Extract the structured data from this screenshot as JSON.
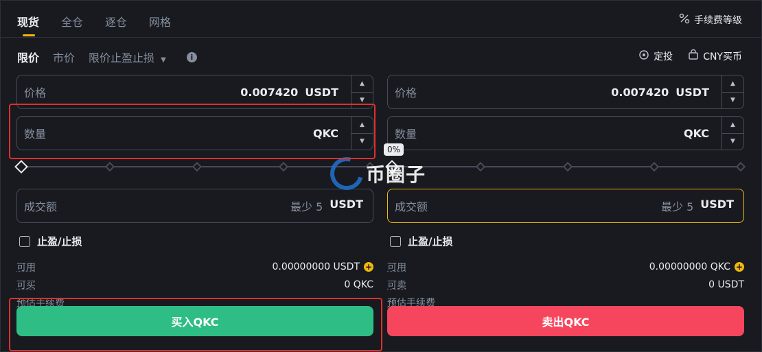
{
  "tabs": [
    "现货",
    "全仓",
    "逐仓",
    "网格"
  ],
  "fee_level": "手续费等级",
  "order_types": {
    "limit": "限价",
    "market": "市价",
    "stop_limit": "限价止盈止损",
    "info": "i"
  },
  "tools": {
    "dca": "定投",
    "cny_buy": "CNY买币"
  },
  "buy": {
    "price_label": "价格",
    "price_value": "0.007420",
    "price_unit": "USDT",
    "qty_label": "数量",
    "qty_unit": "QKC",
    "total_label": "成交额",
    "total_hint": "最少 5",
    "total_unit": "USDT",
    "tpsl_label": "止盈/止损",
    "avail_label": "可用",
    "avail_value": "0.00000000 USDT",
    "max_label": "可买",
    "max_value": "0 QKC",
    "fee_label": "预估手续费",
    "button": "买入QKC"
  },
  "sell": {
    "price_label": "价格",
    "price_value": "0.007420",
    "price_unit": "USDT",
    "qty_label": "数量",
    "qty_unit": "QKC",
    "total_label": "成交额",
    "total_hint": "最少 5",
    "total_unit": "USDT",
    "tpsl_label": "止盈/止损",
    "avail_label": "可用",
    "avail_value": "0.00000000 QKC",
    "max_label": "可卖",
    "max_value": "0 USDT",
    "fee_label": "预估手续费",
    "button": "卖出QKC"
  },
  "slider_tooltip": "0%",
  "watermark": "币圈子",
  "colors": {
    "accent": "#f0b90b",
    "buy": "#2ebd85",
    "sell": "#f6465d",
    "annotation": "#e0302a"
  }
}
